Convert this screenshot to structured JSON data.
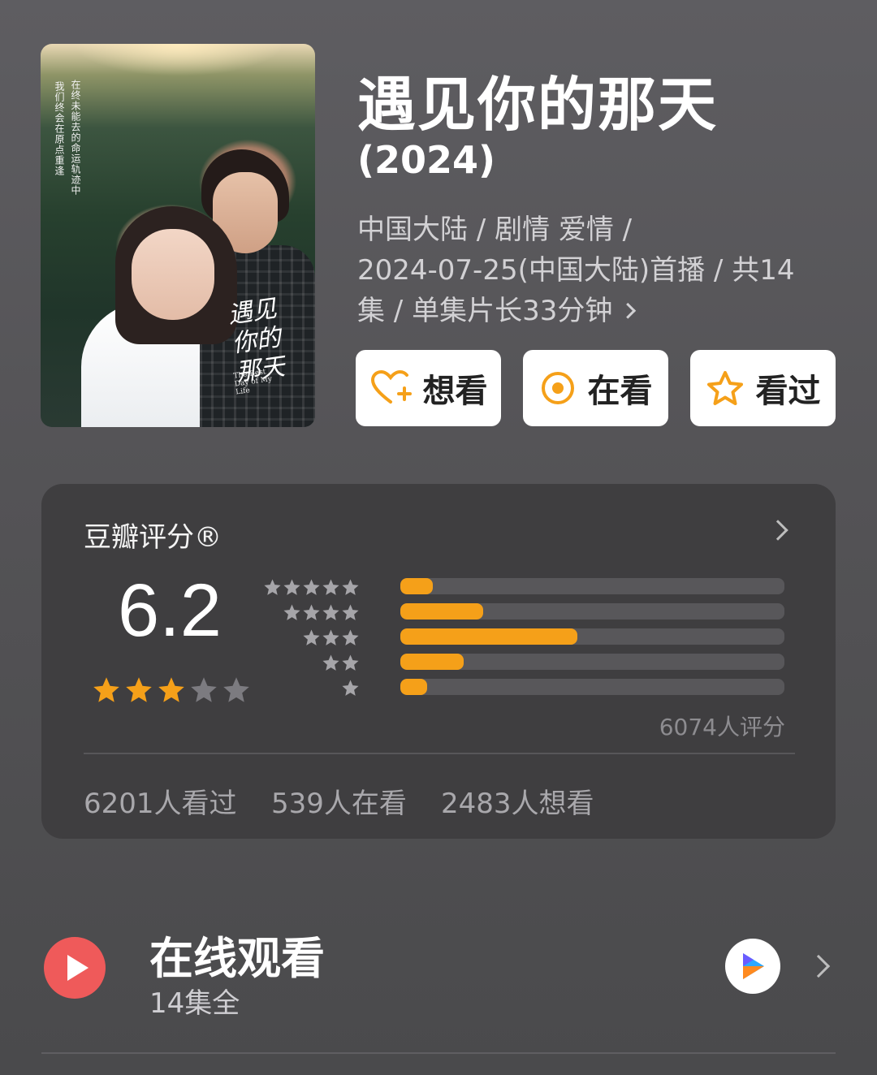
{
  "title": "遇见你的那天",
  "year": "(2024)",
  "meta": {
    "line1": "中国大陆 / 剧情 爱情 /",
    "line2": "2024-07-25(中国大陆)首播 / 共14",
    "line3": "集 / 单集片长33分钟"
  },
  "poster": {
    "tagline_a": "在终未能去的命运轨迹中",
    "tagline_b": "我们终会在原点重逢",
    "art_line1": "遇见",
    "art_line2": "你的",
    "art_line3": "那天",
    "art_en": "The Best Day of My Life"
  },
  "actions": [
    {
      "label": "想看",
      "icon": "heart-plus-icon"
    },
    {
      "label": "在看",
      "icon": "target-circle-icon"
    },
    {
      "label": "看过",
      "icon": "star-outline-icon"
    }
  ],
  "rating": {
    "label": "豆瓣评分®",
    "score": "6.2",
    "score_stars": 3,
    "distribution": [
      {
        "stars": 5,
        "fraction": 0.085
      },
      {
        "stars": 4,
        "fraction": 0.215
      },
      {
        "stars": 3,
        "fraction": 0.46
      },
      {
        "stars": 2,
        "fraction": 0.165
      },
      {
        "stars": 1,
        "fraction": 0.07
      }
    ],
    "count_label": "6074人评分",
    "stats": {
      "watched": "6201人看过",
      "watching": "539人在看",
      "wish": "2483人想看"
    }
  },
  "online": {
    "title": "在线观看",
    "subtitle": "14集全"
  },
  "colors": {
    "accent": "#f5a019",
    "star_inactive": "#7c7b80",
    "play": "#ef5a5a"
  }
}
